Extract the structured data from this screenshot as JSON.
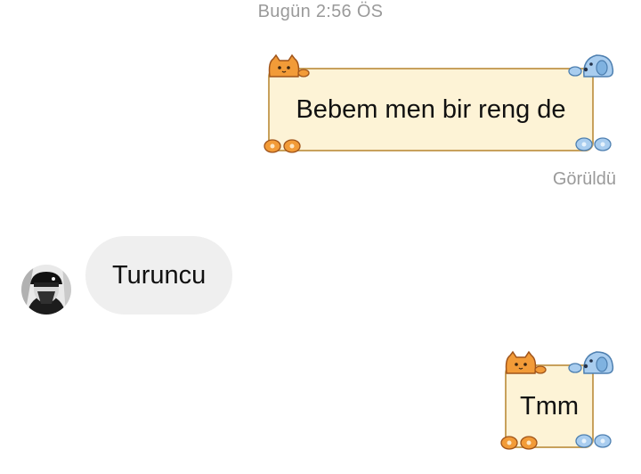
{
  "chat": {
    "timestamp": "Bugün 2:56 ÖS",
    "messages": [
      {
        "direction": "outgoing",
        "text": "Bebem men bir reng de"
      },
      {
        "direction": "incoming",
        "text": "Turuncu"
      },
      {
        "direction": "outgoing",
        "text": "Tmm"
      }
    ],
    "seen_label": "Görüldü"
  },
  "theme": {
    "bubble_fill": "#fdf3d6",
    "bubble_border": "#c8a15c",
    "cat_color": "#f29b38",
    "dog_color": "#a9cdef",
    "incoming_bubble": "#efefef",
    "meta_text": "#9a9a9a"
  },
  "icons": [
    "cat-sticker-icon",
    "dog-sticker-icon",
    "orange-paw-icon",
    "blue-paw-icon",
    "avatar"
  ]
}
